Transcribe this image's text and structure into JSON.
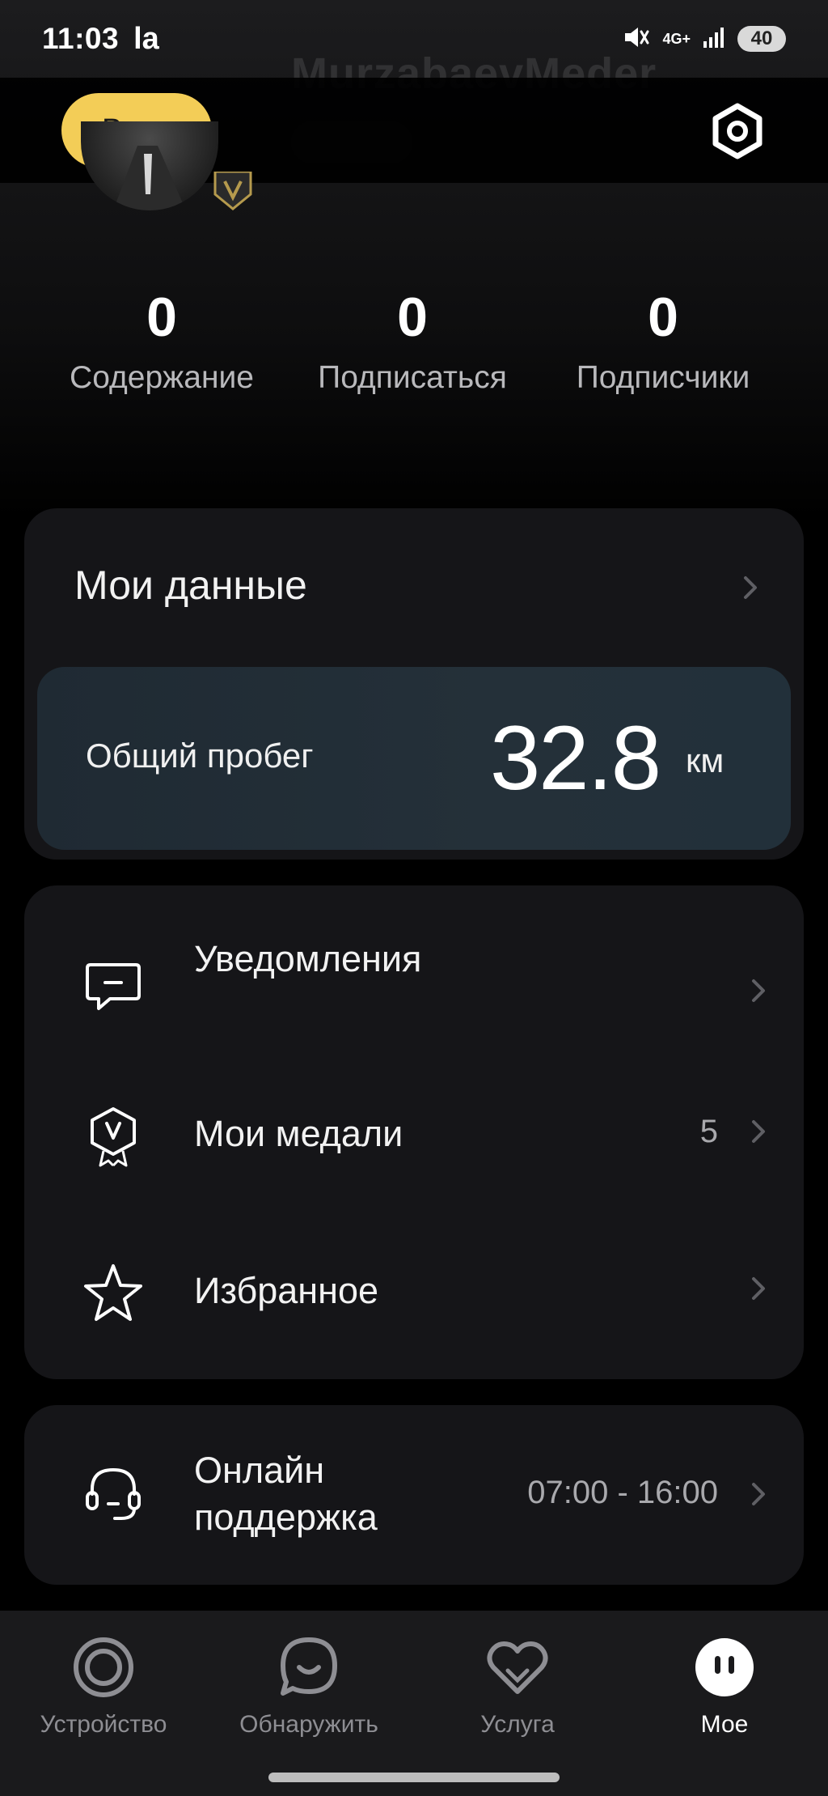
{
  "status_bar": {
    "time": "11:03",
    "app_indicator": "la",
    "network": "4G+",
    "battery": "40"
  },
  "profile_background": {
    "username": "MurzabaevMeder"
  },
  "header": {
    "login_label": "Вход"
  },
  "stats": [
    {
      "value": "0",
      "label": "Содержание"
    },
    {
      "value": "0",
      "label": "Подписаться"
    },
    {
      "value": "0",
      "label": "Подписчики"
    }
  ],
  "my_data": {
    "title": "Мои данные",
    "mileage_label": "Общий пробег",
    "mileage_value": "32.8",
    "mileage_unit": "км"
  },
  "menu": {
    "notifications": "Уведомления",
    "medals": "Мои медали",
    "medals_count": "5",
    "favorites": "Избранное"
  },
  "support": {
    "label": "Онлайн поддержка",
    "hours": "07:00 - 16:00"
  },
  "bottom_nav": [
    {
      "label": "Устройство",
      "icon": "device-ring-icon"
    },
    {
      "label": "Обнаружить",
      "icon": "discover-chat-icon"
    },
    {
      "label": "Услуга",
      "icon": "service-heart-icon"
    },
    {
      "label": "Мое",
      "icon": "profile-face-icon",
      "active": true
    }
  ],
  "colors": {
    "accent": "#f3cd57",
    "card": "#151518",
    "mileage_card": "#22303a",
    "text_secondary": "#b9b9bc"
  }
}
